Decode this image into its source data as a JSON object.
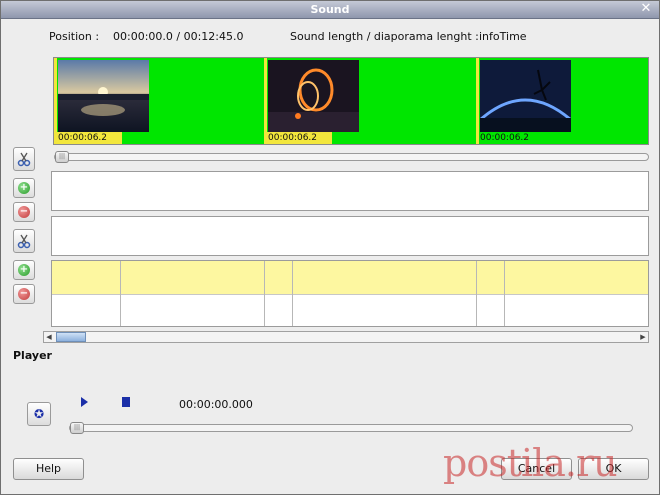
{
  "window": {
    "title": "Sound",
    "close_glyph": "✕"
  },
  "info": {
    "position_label": "Position :",
    "position_value": "00:00:00.0 / 00:12:45.0",
    "length_label": "Sound length / diaporama lenght :",
    "length_value": "infoTime"
  },
  "clips": [
    {
      "timecode": "00:00:06.2"
    },
    {
      "timecode": "00:00:06.2"
    },
    {
      "timecode": "00:00:06.2"
    }
  ],
  "player": {
    "section_label": "Player",
    "time": "00:00:00.000"
  },
  "buttons": {
    "help": "Help",
    "cancel": "Cancel",
    "ok": "OK"
  },
  "watermark": "postila.ru",
  "colors": {
    "strip_green": "#00e600",
    "highlight_yellow": "#f2e63c",
    "row_yellow": "#fdf7a0",
    "accent_blue": "#1b2fa8"
  },
  "icons": [
    "close-icon",
    "scissors-icon",
    "plus-icon",
    "minus-icon",
    "refresh-icon",
    "play-icon",
    "stop-icon"
  ]
}
